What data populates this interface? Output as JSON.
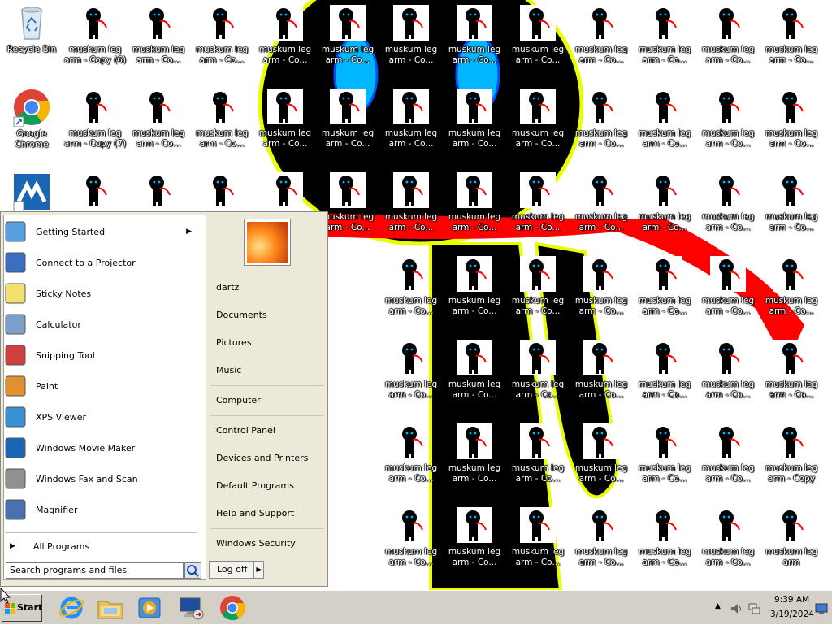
{
  "desktop": {
    "recycle_bin": "Recycle Bin",
    "chrome": "Google Chrome",
    "icon_label_copy6": "muskum leg\narm - Copy (6)",
    "icon_label_copy7": "muskum leg\narm - Copy (7)",
    "icon_label_trunc": "muskum leg\narm - Co...",
    "icon_label_copy": "muskum leg\narm - Copy",
    "icon_label_plain": "muskum leg\narm"
  },
  "start_menu": {
    "programs": [
      {
        "label": "Getting Started",
        "has_submenu": true
      },
      {
        "label": "Connect to a Projector"
      },
      {
        "label": "Sticky Notes"
      },
      {
        "label": "Calculator"
      },
      {
        "label": "Snipping Tool"
      },
      {
        "label": "Paint"
      },
      {
        "label": "XPS Viewer"
      },
      {
        "label": "Windows Movie Maker"
      },
      {
        "label": "Windows Fax and Scan"
      },
      {
        "label": "Magnifier"
      }
    ],
    "all_programs": "All Programs",
    "search_placeholder": "Search programs and files",
    "right": {
      "user": "dartz",
      "documents": "Documents",
      "pictures": "Pictures",
      "music": "Music",
      "computer": "Computer",
      "control_panel": "Control Panel",
      "devices_printers": "Devices and Printers",
      "default_programs": "Default Programs",
      "help_support": "Help and Support",
      "windows_security": "Windows Security"
    },
    "logoff": "Log off"
  },
  "taskbar": {
    "start_label": "Start",
    "pinned": [
      "internet-explorer",
      "windows-explorer",
      "media-player",
      "remote-desktop",
      "google-chrome"
    ],
    "clock_time": "9:39 AM",
    "clock_date": "3/19/2024"
  },
  "colors": {
    "taskbar": "#d4d0c8",
    "start_menu_bg": "#ece9d8",
    "wallpaper_black": "#000000",
    "wallpaper_red": "#ff0000",
    "wallpaper_eye": "#00b7ff",
    "wallpaper_outline": "#e8ff00"
  }
}
